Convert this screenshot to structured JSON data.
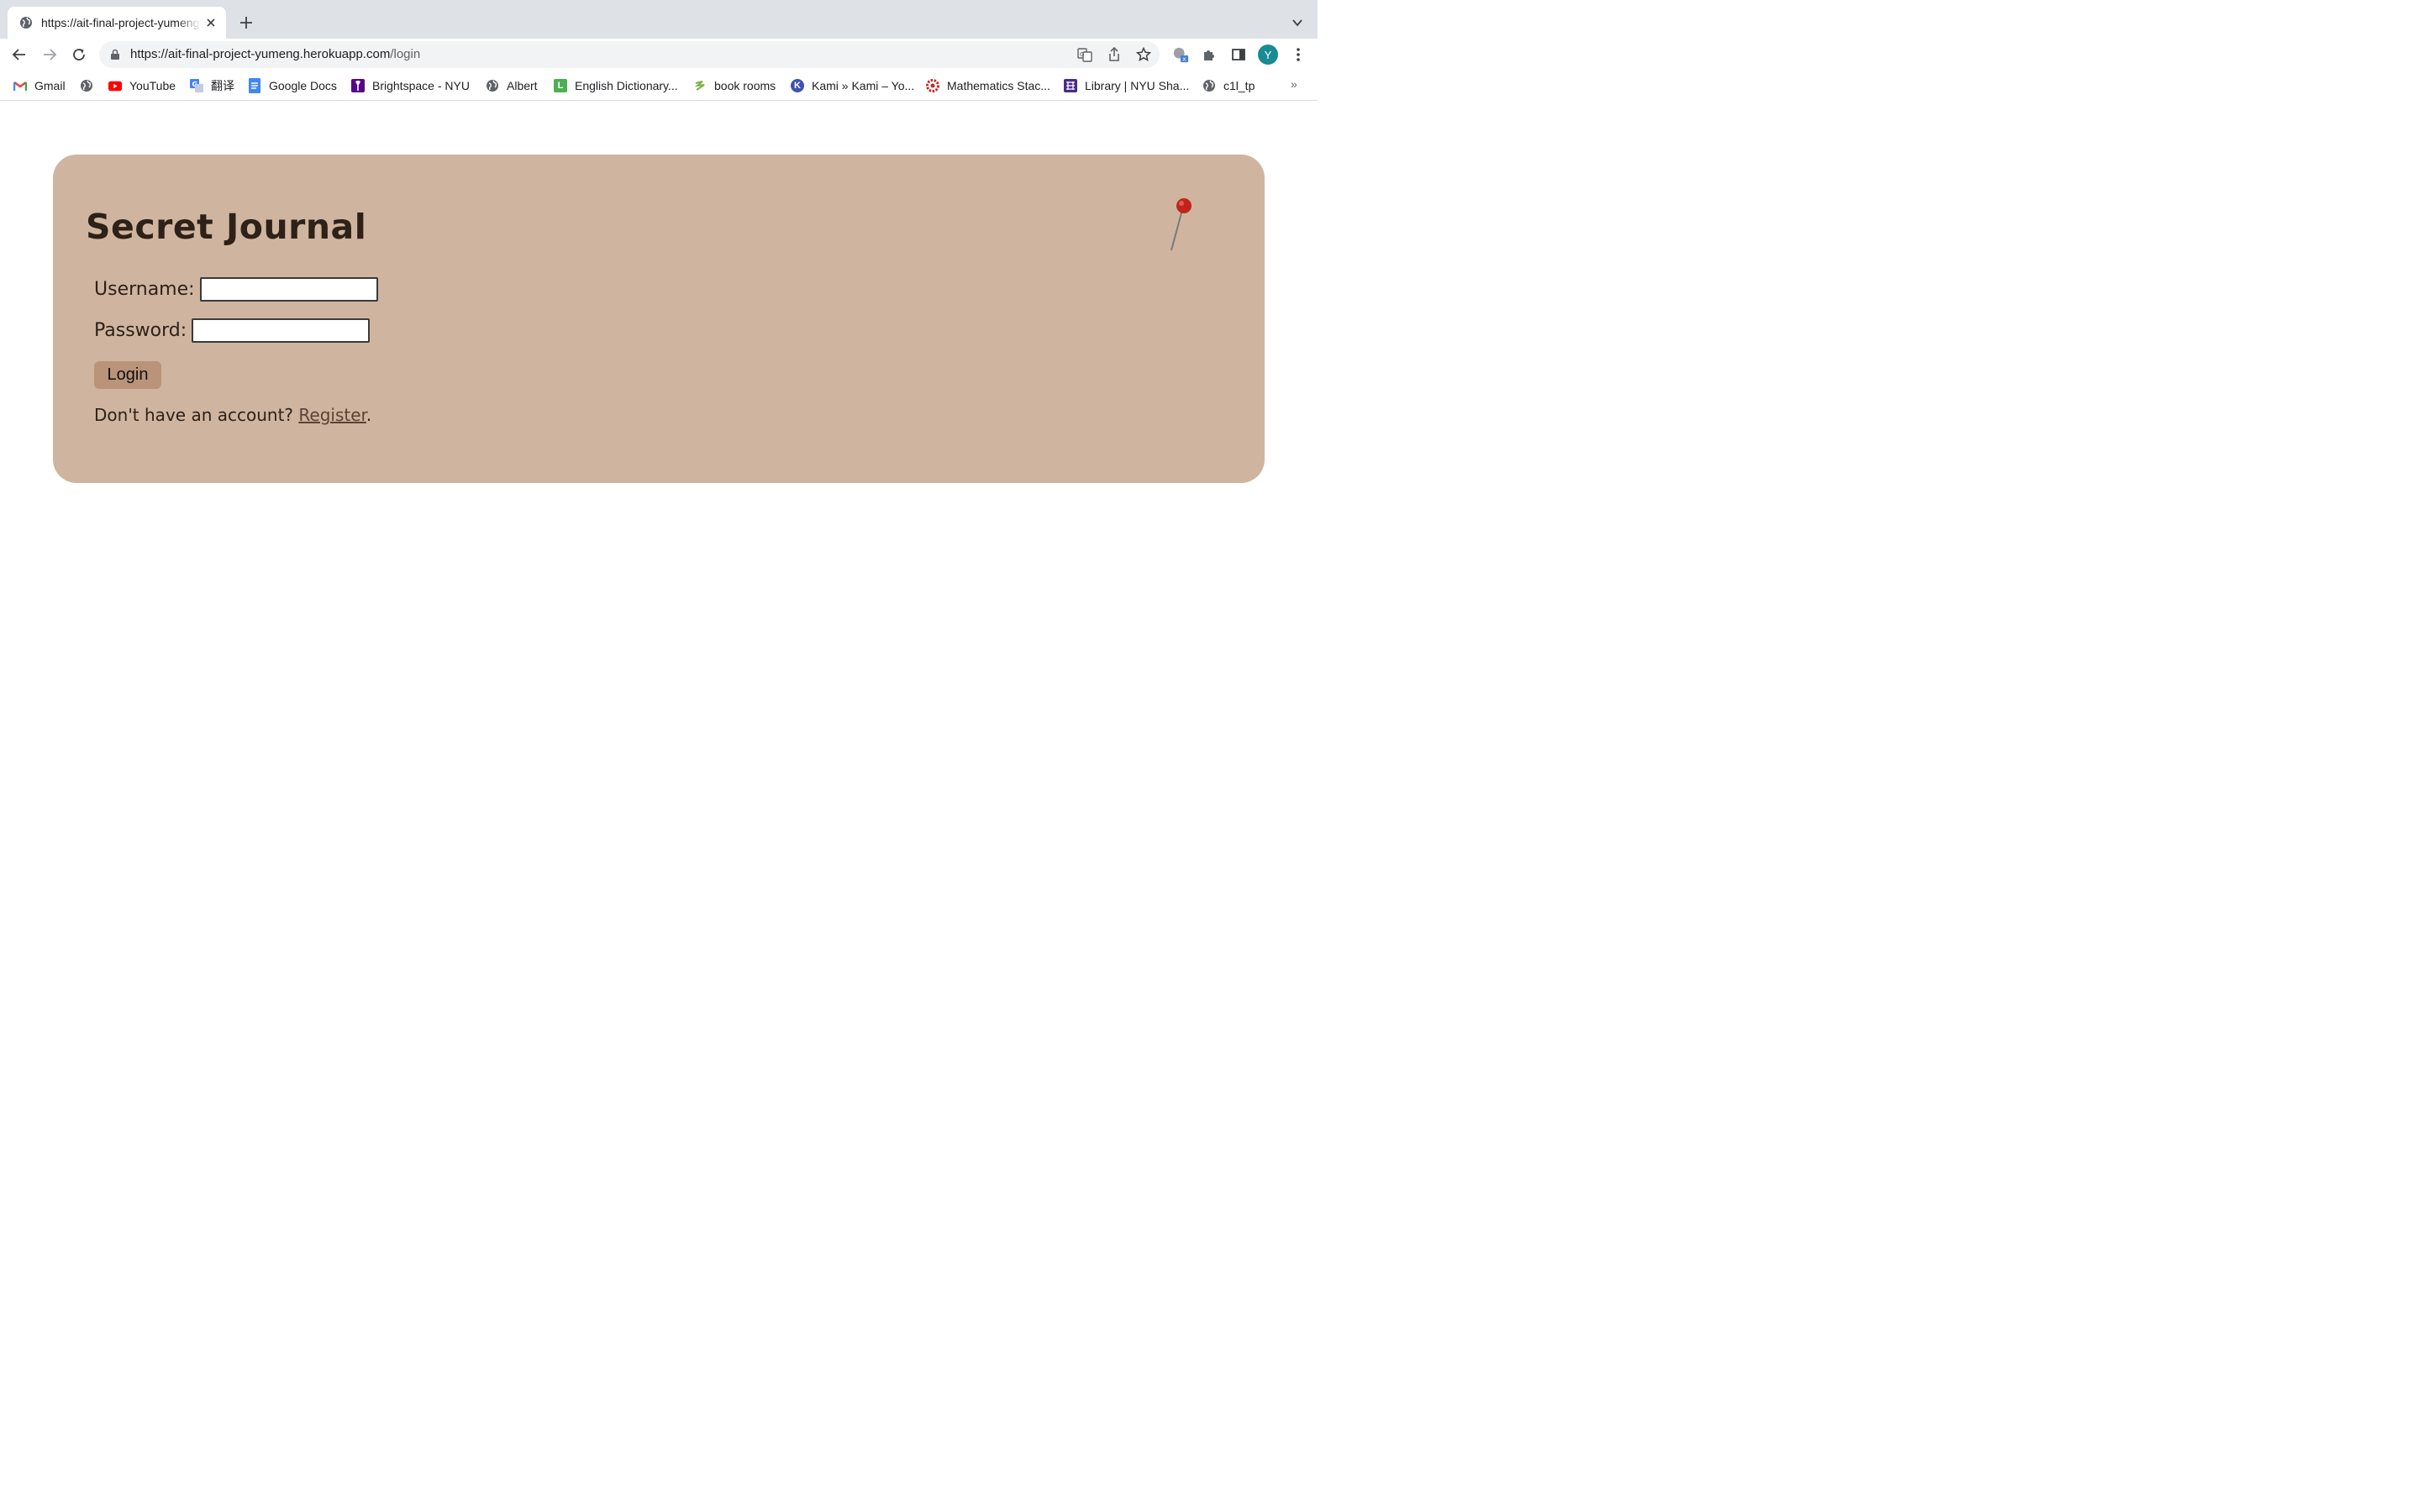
{
  "browser": {
    "tab": {
      "title": "https://ait-final-project-yumeng.herokuapp.com/login"
    },
    "url": {
      "host": "https://ait-final-project-yumeng.herokuapp.com",
      "path": "/login"
    },
    "avatar_initial": "Y",
    "bookmarks": [
      {
        "label": "Gmail",
        "icon": "gmail-icon"
      },
      {
        "label": "",
        "icon": "globe-icon"
      },
      {
        "label": "YouTube",
        "icon": "youtube-icon"
      },
      {
        "label": "翻译",
        "icon": "translate-icon"
      },
      {
        "label": "Google Docs",
        "icon": "docs-icon"
      },
      {
        "label": "Brightspace - NYU",
        "icon": "nyu-torch-icon"
      },
      {
        "label": "Albert",
        "icon": "globe-icon"
      },
      {
        "label": "English Dictionary...",
        "icon": "dictionary-icon"
      },
      {
        "label": "book rooms",
        "icon": "leaf-icon"
      },
      {
        "label": "Kami » Kami – Yo...",
        "icon": "kami-icon"
      },
      {
        "label": "Mathematics Stac...",
        "icon": "math-stack-icon"
      },
      {
        "label": "Library | NYU Sha...",
        "icon": "library-icon"
      },
      {
        "label": "c1l_tp",
        "icon": "globe-icon"
      }
    ],
    "more_bookmarks": "»"
  },
  "page": {
    "title": "Secret Journal",
    "username_label": "Username:",
    "username_value": "",
    "password_label": "Password:",
    "password_value": "",
    "login_button": "Login",
    "register_prompt": "Don't have an account?",
    "register_link": "Register",
    "register_suffix": "."
  },
  "colors": {
    "card_background": "#cfb59f",
    "button_background": "#b99479",
    "text_dark": "#2e2117",
    "pin_red": "#c0251b"
  }
}
